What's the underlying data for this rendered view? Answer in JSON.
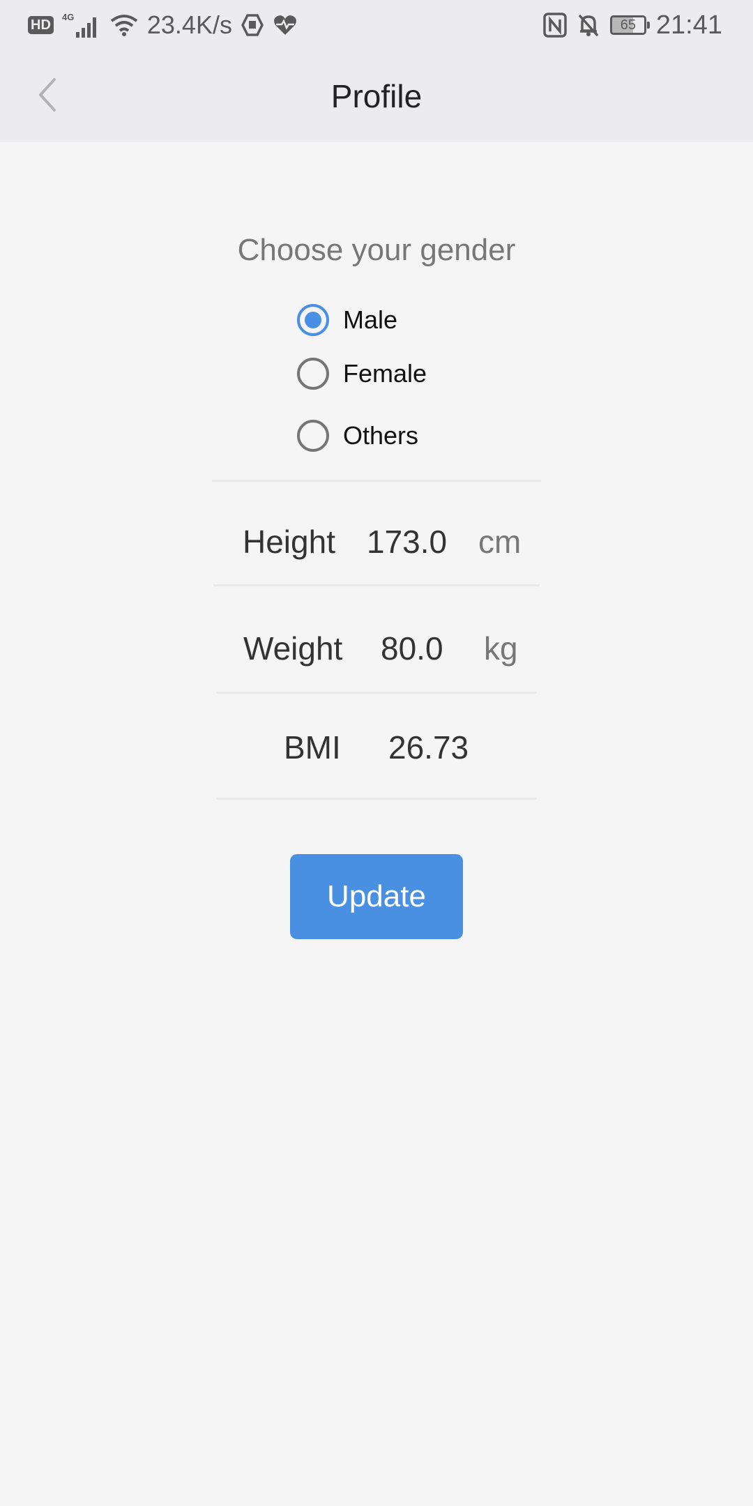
{
  "status_bar": {
    "hd_badge": "HD",
    "network_badge": "4G",
    "net_speed": "23.4K/s",
    "battery_level": "65",
    "time": "21:41",
    "icons": [
      "hd-icon",
      "signal-4g-icon",
      "wifi-icon",
      "shield-icon",
      "heart-pulse-icon",
      "nfc-icon",
      "bell-off-icon",
      "battery-icon"
    ]
  },
  "app_bar": {
    "title": "Profile",
    "back_icon": "chevron-left-icon"
  },
  "gender": {
    "heading": "Choose your gender",
    "options": [
      {
        "label": "Male",
        "selected": true
      },
      {
        "label": "Female",
        "selected": false
      },
      {
        "label": "Others",
        "selected": false
      }
    ]
  },
  "fields": {
    "height": {
      "label": "Height",
      "value": "173.0",
      "unit": "cm"
    },
    "weight": {
      "label": "Weight",
      "value": "80.0",
      "unit": "kg"
    },
    "bmi": {
      "label": "BMI",
      "value": "26.73"
    }
  },
  "actions": {
    "update_label": "Update"
  },
  "colors": {
    "accent": "#4a90e2",
    "background": "#f5f5f5",
    "bar_background": "#ececee"
  }
}
